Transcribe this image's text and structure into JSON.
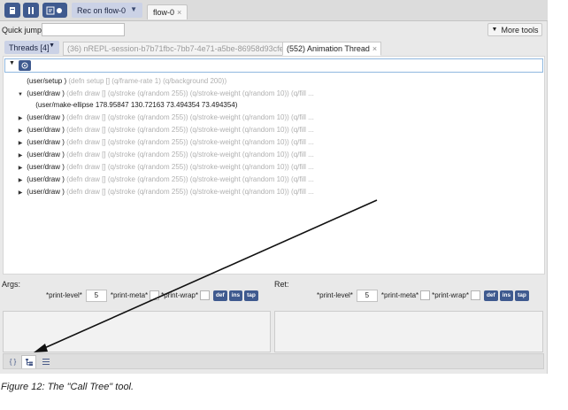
{
  "toolbar": {
    "icons": [
      "stop-icon",
      "pause-icon",
      "record-flow-icon"
    ],
    "rec_label": "Rec on flow-0",
    "flow_tab": "flow-0",
    "close_glyph": "×"
  },
  "quick_jump": {
    "label": "Quick jump:",
    "value": "",
    "more_tools": "More tools"
  },
  "threads": {
    "selector": "Threads [4]",
    "tabs": [
      {
        "label": "(36) nREPL-session-b7b71fbc-7bb7-4e71-a5be-86958d93cfe5",
        "active": false
      },
      {
        "label": "(552) Animation Thread",
        "active": true
      }
    ]
  },
  "tree": {
    "rows": [
      {
        "toggle": "",
        "fn": "(user/setup )",
        "args": "(defn setup [] (q/frame-rate 1) (q/background 200))"
      },
      {
        "toggle": "▼",
        "fn": "(user/draw )",
        "args": "(defn draw [] (q/stroke (q/random 255)) (q/stroke-weight (q/random 10)) (q/fill ..."
      },
      {
        "toggle": "",
        "fn": "(user/make-ellipse 178.95847 130.72163 73.494354 73.494354)",
        "args": ""
      },
      {
        "toggle": "▶",
        "fn": "(user/draw )",
        "args": "(defn draw [] (q/stroke (q/random 255)) (q/stroke-weight (q/random 10)) (q/fill ..."
      },
      {
        "toggle": "▶",
        "fn": "(user/draw )",
        "args": "(defn draw [] (q/stroke (q/random 255)) (q/stroke-weight (q/random 10)) (q/fill ..."
      },
      {
        "toggle": "▶",
        "fn": "(user/draw )",
        "args": "(defn draw [] (q/stroke (q/random 255)) (q/stroke-weight (q/random 10)) (q/fill ..."
      },
      {
        "toggle": "▶",
        "fn": "(user/draw )",
        "args": "(defn draw [] (q/stroke (q/random 255)) (q/stroke-weight (q/random 10)) (q/fill ..."
      },
      {
        "toggle": "▶",
        "fn": "(user/draw )",
        "args": "(defn draw [] (q/stroke (q/random 255)) (q/stroke-weight (q/random 10)) (q/fill ..."
      },
      {
        "toggle": "▶",
        "fn": "(user/draw )",
        "args": "(defn draw [] (q/stroke (q/random 255)) (q/stroke-weight (q/random 10)) (q/fill ..."
      },
      {
        "toggle": "▶",
        "fn": "(user/draw )",
        "args": "(defn draw [] (q/stroke (q/random 255)) (q/stroke-weight (q/random 10)) (q/fill ..."
      }
    ]
  },
  "args_panel": {
    "label": "Args:",
    "print_level_label": "*print-level*",
    "print_level": "5",
    "print_meta_label": "*print-meta*",
    "print_wrap_label": "*print-wrap*",
    "def": "def",
    "ins": "ins",
    "tap": "tap"
  },
  "ret_panel": {
    "label": "Ret:",
    "print_level_label": "*print-level*",
    "print_level": "5",
    "print_meta_label": "*print-meta*",
    "print_wrap_label": "*print-wrap*",
    "def": "def",
    "ins": "ins",
    "tap": "tap"
  },
  "bottom_tools": [
    {
      "icon": "code-braces-icon",
      "glyph": "{ }",
      "active": false
    },
    {
      "icon": "call-tree-icon",
      "active": true
    },
    {
      "icon": "list-icon",
      "active": false
    }
  ],
  "caption": "Figure 12: The \"Call Tree\" tool.",
  "colors": {
    "accent": "#3f5a8f",
    "select_bg": "#cbd2e6",
    "annotation_arrow": "#111111"
  }
}
